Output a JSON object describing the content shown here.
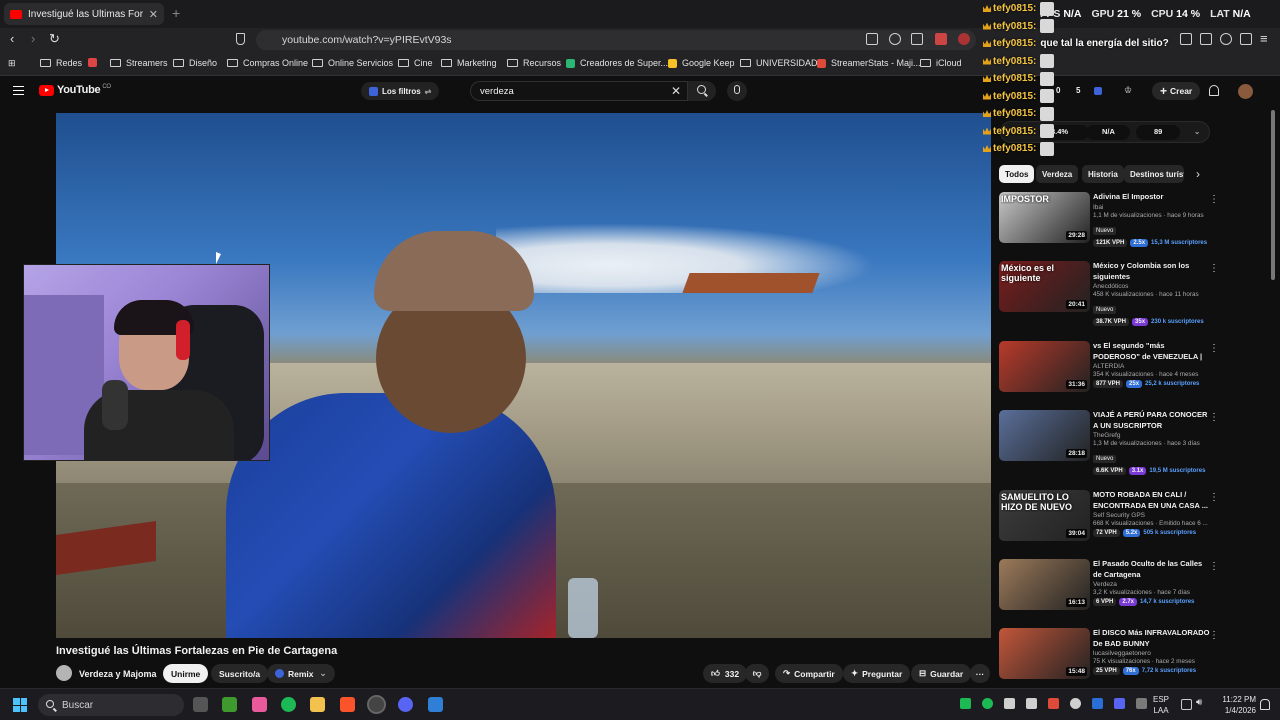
{
  "browser": {
    "tab_title": "Investigué las Últimas Fortalezas en Pie de Cartagena",
    "url": "youtube.com/watch?v=yPIREvtV93s",
    "bookmarks": [
      "Redes",
      "Streamers",
      "Diseño",
      "Compras Online",
      "Online Servicios",
      "Cine",
      "Marketing",
      "Recursos",
      "Creadores de Super...",
      "Google Keep",
      "UNIVERSIDAD",
      "StreamerStats - Maji...",
      "iCloud"
    ]
  },
  "youtube": {
    "logo_text": "YouTube",
    "logo_country": "CO",
    "filters_label": "Los filtros",
    "search_value": "verdeza",
    "create_label": "Crear",
    "header_stats": {
      "s1": "0",
      "s2": "5"
    },
    "stats_row": [
      "3.4%",
      "N/A",
      "89"
    ],
    "video": {
      "title": "Investigué las Últimas Fortalezas en Pie de Cartagena",
      "channel": "Verdeza y Majoma",
      "join_label": "Unirme",
      "subscribed_label": "Suscrito/a",
      "remix_label": "Remix",
      "likes": "332",
      "share_label": "Compartir",
      "ask_label": "Preguntar",
      "save_label": "Guardar"
    },
    "chips": [
      "Todos",
      "Verdeza",
      "Historia",
      "Destinos turísticos"
    ],
    "recommendations": [
      {
        "title": "Adivina El Impostor",
        "channel": "Ibai",
        "meta": "1,1 M de visualizaciones · hace 9 horas",
        "duration": "29:28",
        "new": "Nuevo",
        "vph": "121K VPH",
        "x": "2.5x",
        "subs": "15,3 M suscriptores",
        "thumb_text": "IMPOSTOR",
        "color": "#c8c8c8"
      },
      {
        "title": "México y Colombia son los siguientes",
        "channel": "Anecdóticos",
        "meta": "458 K visualizaciones · hace 11 horas",
        "duration": "20:41",
        "new": "Nuevo",
        "vph": "38.7K VPH",
        "x": "35x",
        "subs": "230 k suscriptores",
        "thumb_text": "México es el siguiente",
        "color": "#7a1c1c"
      },
      {
        "title": "vs El segundo \"más PODEROSO\" de VENEZUELA | Documental ...",
        "channel": "ALTERDIA",
        "meta": "354 K visualizaciones · hace 4 meses",
        "duration": "31:36",
        "new": "",
        "vph": "877 VPH",
        "x": "25x",
        "subs": "25,2 k suscriptores",
        "thumb_text": "",
        "color": "#b83a2a"
      },
      {
        "title": "VIAJÉ A PERÚ PARA CONOCER A UN SUSCRIPTOR",
        "channel": "TheGrefg",
        "meta": "1,3 M de visualizaciones · hace 3 días",
        "duration": "28:18",
        "new": "Nuevo",
        "vph": "6.6K VPH",
        "x": "3.1x",
        "subs": "19,5 M suscriptores",
        "thumb_text": "",
        "color": "#5a6f9a"
      },
      {
        "title": "MOTO ROBADA EN CALI / ENCONTRADA EN UNA CASA ...",
        "channel": "Self Security GPS",
        "meta": "668 K visualizaciones · Emitido hace 6 ...",
        "duration": "39:04",
        "new": "",
        "vph": "72 VPH",
        "x": "5.2x",
        "subs": "505 k suscriptores",
        "thumb_text": "SAMUELITO LO HIZO DE NUEVO",
        "color": "#3c3c3c"
      },
      {
        "title": "El Pasado Oculto de las Calles de Cartagena",
        "channel": "Verdeza",
        "meta": "3,2 K visualizaciones · hace 7 días",
        "duration": "16:13",
        "new": "",
        "vph": "6 VPH",
        "x": "2.7x",
        "subs": "14,7 k suscriptores",
        "thumb_text": "",
        "color": "#9c7a5a"
      },
      {
        "title": "El DISCO Más INFRAVALORADO De BAD BUNNY",
        "channel": "lucasilveggaetonero",
        "meta": "75 K visualizaciones · hace 2 meses",
        "duration": "15:48",
        "new": "",
        "vph": "25 VPH",
        "x": "76x",
        "subs": "7,72 k suscriptores",
        "thumb_text": "",
        "color": "#c2563a"
      }
    ]
  },
  "overlay": {
    "hud": {
      "fps_label": "FPS",
      "fps_value": "N/A",
      "gpu_label": "GPU",
      "gpu_value": "21 %",
      "cpu_label": "CPU",
      "cpu_value": "14 %",
      "lat_label": "LAT",
      "lat_value": "N/A"
    },
    "chat": [
      {
        "user": "tefy0815:",
        "msg": "",
        "emote": true
      },
      {
        "user": "tefy0815:",
        "msg": "",
        "emote": true
      },
      {
        "user": "tefy0815:",
        "msg": "que tal la energía del sitio?",
        "emote": false
      },
      {
        "user": "tefy0815:",
        "msg": "",
        "emote": true
      },
      {
        "user": "tefy0815:",
        "msg": "",
        "emote": true
      },
      {
        "user": "tefy0815:",
        "msg": "",
        "emote": true
      },
      {
        "user": "tefy0815:",
        "msg": "",
        "emote": true
      },
      {
        "user": "tefy0815:",
        "msg": "",
        "emote": true
      },
      {
        "user": "tefy0815:",
        "msg": "",
        "emote": true
      }
    ]
  },
  "taskbar": {
    "search_placeholder": "Buscar",
    "lang_line1": "ESP",
    "lang_line2": "LAA",
    "time": "11:22 PM",
    "date": "1/4/2026"
  }
}
